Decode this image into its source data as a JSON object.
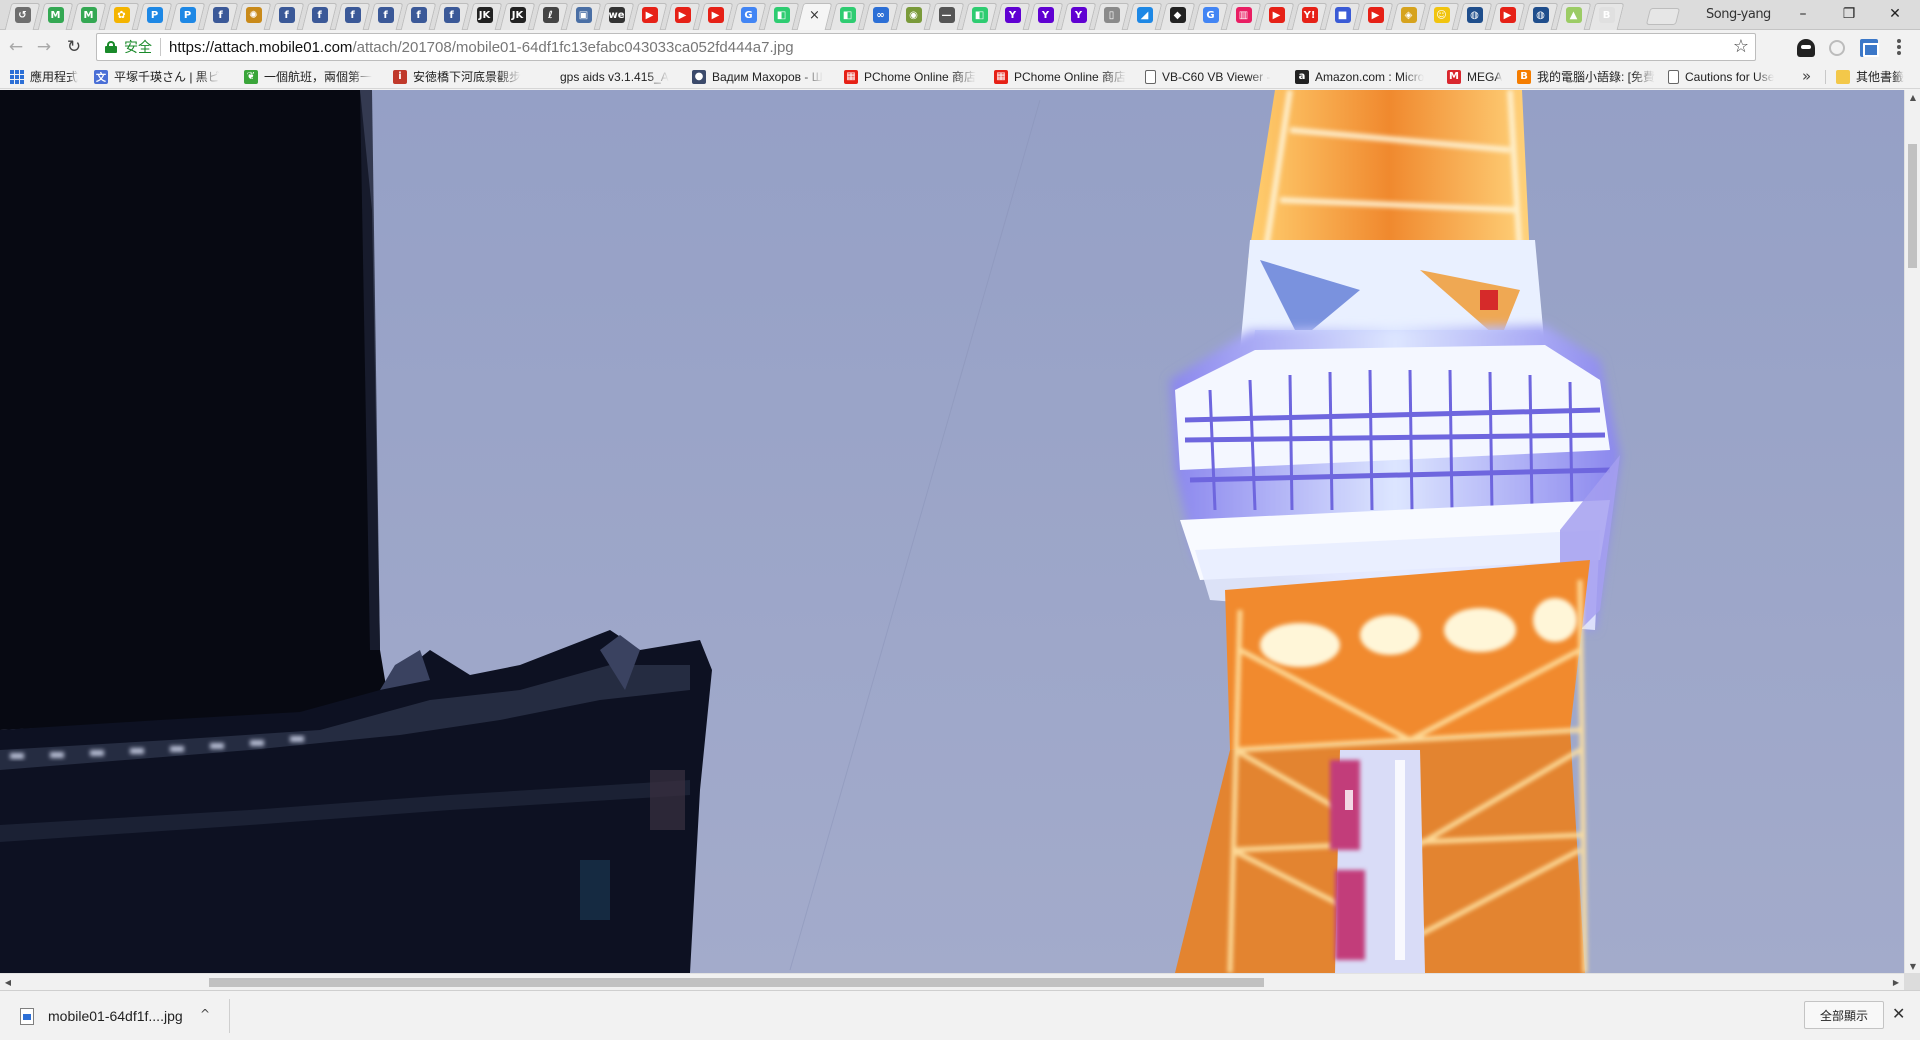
{
  "browser": {
    "profile_name": "Song-yang",
    "window_controls": {
      "minimize": "–",
      "restore": "❐",
      "close": "✕"
    },
    "active_tab_close": "×"
  },
  "tabs": [
    {
      "icon": "history-icon",
      "glyph": "↺",
      "color": "#6e6e6e"
    },
    {
      "icon": "google-maps-icon",
      "glyph": "M",
      "color": "#34a853"
    },
    {
      "icon": "google-maps-icon",
      "glyph": "M",
      "color": "#34a853"
    },
    {
      "icon": "google-photos-icon",
      "glyph": "✿",
      "color": "#f4b400"
    },
    {
      "icon": "pixnet-icon",
      "glyph": "P",
      "color": "#1e88e5"
    },
    {
      "icon": "pixnet-icon",
      "glyph": "P",
      "color": "#1e88e5"
    },
    {
      "icon": "facebook-icon",
      "glyph": "f",
      "color": "#3b5998"
    },
    {
      "icon": "wheel-icon",
      "glyph": "✺",
      "color": "#c98a1a"
    },
    {
      "icon": "facebook-icon",
      "glyph": "f",
      "color": "#3b5998"
    },
    {
      "icon": "facebook-icon",
      "glyph": "f",
      "color": "#3b5998"
    },
    {
      "icon": "facebook-icon",
      "glyph": "f",
      "color": "#3b5998"
    },
    {
      "icon": "facebook-icon",
      "glyph": "f",
      "color": "#3b5998"
    },
    {
      "icon": "facebook-icon",
      "glyph": "f",
      "color": "#3b5998"
    },
    {
      "icon": "facebook-icon",
      "glyph": "f",
      "color": "#3b5998"
    },
    {
      "icon": "jk-icon",
      "glyph": "JK",
      "color": "#222222"
    },
    {
      "icon": "jk-icon",
      "glyph": "JK",
      "color": "#222222"
    },
    {
      "icon": "feather-icon",
      "glyph": "ℓ",
      "color": "#444444"
    },
    {
      "icon": "map-pin-icon",
      "glyph": "▣",
      "color": "#4a6fa5"
    },
    {
      "icon": "wechat-icon",
      "glyph": "we",
      "color": "#333333"
    },
    {
      "icon": "youtube-icon",
      "glyph": "▶",
      "color": "#e62117"
    },
    {
      "icon": "youtube-icon",
      "glyph": "▶",
      "color": "#e62117"
    },
    {
      "icon": "youtube-icon",
      "glyph": "▶",
      "color": "#e62117"
    },
    {
      "icon": "google-icon",
      "glyph": "G",
      "color": "#4285f4"
    },
    {
      "icon": "green-app-icon",
      "glyph": "◧",
      "color": "#2ecc71"
    },
    {
      "icon": "close-tab-icon",
      "glyph": "×",
      "color": "#333333",
      "active": true
    },
    {
      "icon": "green-app-icon",
      "glyph": "◧",
      "color": "#2ecc71"
    },
    {
      "icon": "link-icon",
      "glyph": "∞",
      "color": "#2c6fd6"
    },
    {
      "icon": "android-icon",
      "glyph": "◉",
      "color": "#7a9a3a"
    },
    {
      "icon": "dash-icon",
      "glyph": "—",
      "color": "#555555"
    },
    {
      "icon": "green-app-icon",
      "glyph": "◧",
      "color": "#2ecc71"
    },
    {
      "icon": "yahoo-icon",
      "glyph": "Y",
      "color": "#6001d2"
    },
    {
      "icon": "yahoo-icon",
      "glyph": "Y",
      "color": "#6001d2"
    },
    {
      "icon": "yahoo-icon",
      "glyph": "Y",
      "color": "#6001d2"
    },
    {
      "icon": "document-icon",
      "glyph": "▯",
      "color": "#8a8a8a"
    },
    {
      "icon": "chart-icon",
      "glyph": "◢",
      "color": "#1e88e5"
    },
    {
      "icon": "drop-icon",
      "glyph": "◆",
      "color": "#222222"
    },
    {
      "icon": "google-icon",
      "glyph": "G",
      "color": "#4285f4"
    },
    {
      "icon": "pink-app-icon",
      "glyph": "▥",
      "color": "#e91e63"
    },
    {
      "icon": "youtube-icon",
      "glyph": "▶",
      "color": "#e62117"
    },
    {
      "icon": "yahoo-tw-icon",
      "glyph": "Y!",
      "color": "#e62117"
    },
    {
      "icon": "chat-icon",
      "glyph": "■",
      "color": "#3a5bd6"
    },
    {
      "icon": "youtube-icon",
      "glyph": "▶",
      "color": "#e62117"
    },
    {
      "icon": "shield-icon",
      "glyph": "◈",
      "color": "#d6a31e"
    },
    {
      "icon": "smile-icon",
      "glyph": "☺",
      "color": "#f1c40f"
    },
    {
      "icon": "globe-icon",
      "glyph": "◍",
      "color": "#1f4e8c"
    },
    {
      "icon": "youtube-icon",
      "glyph": "▶",
      "color": "#e62117"
    },
    {
      "icon": "globe-icon",
      "glyph": "◍",
      "color": "#1f4e8c"
    },
    {
      "icon": "android-icon",
      "glyph": "▲",
      "color": "#9ccc65"
    },
    {
      "icon": "blank-b-icon",
      "glyph": "B",
      "color": "#e0e0e0"
    }
  ],
  "toolbar": {
    "back": "←",
    "forward": "→",
    "reload": "↻",
    "secure_label": "安全",
    "url_host": "https://attach.mobile01.com",
    "url_path": "/attach/201708/mobile01-64df1fc13efabc043033ca052fd444a7.jpg",
    "star": "☆"
  },
  "bookmarks": [
    {
      "label": "應用程式",
      "icon": "apps-grid-icon",
      "color": "#2c6fd6",
      "glyph": ""
    },
    {
      "label": "平塚千瑛さん | 黒ビ",
      "icon": "translate-icon",
      "color": "#4a6fd6",
      "glyph": "文"
    },
    {
      "label": "一個航班，兩個第一",
      "icon": "bird-icon",
      "color": "#3aa53a",
      "glyph": "❦"
    },
    {
      "label": "安徳橋下河底景觀步",
      "icon": "iyf-icon",
      "color": "#c0392b",
      "glyph": "i"
    },
    {
      "label": "gps aids v3.1.415_A",
      "icon": "blank-icon",
      "color": "#f2f2f2",
      "glyph": ""
    },
    {
      "label": "Вадим Махоров - Ш",
      "icon": "person-icon",
      "color": "#3b4a6b",
      "glyph": "●"
    },
    {
      "label": "PChome Online 商店",
      "icon": "pchome-icon",
      "color": "#e62117",
      "glyph": "▦"
    },
    {
      "label": "PChome Online 商店",
      "icon": "pchome-icon",
      "color": "#e62117",
      "glyph": "▦"
    },
    {
      "label": "VB-C60 VB Viewer -",
      "icon": "page-icon",
      "color": "#ffffff",
      "glyph": ""
    },
    {
      "label": "Amazon.com : Micro",
      "icon": "amazon-icon",
      "color": "#222222",
      "glyph": "a"
    },
    {
      "label": "MEGA",
      "icon": "mega-icon",
      "color": "#d9272e",
      "glyph": "M"
    },
    {
      "label": "我的電腦小語錄: [免費",
      "icon": "blogger-icon",
      "color": "#f57d00",
      "glyph": "B"
    },
    {
      "label": "Cautions for Use",
      "icon": "page-icon",
      "color": "#ffffff",
      "glyph": ""
    }
  ],
  "bookmarks_overflow": "»",
  "other_bookmarks": "其他書籤",
  "download": {
    "filename": "mobile01-64df1f....jpg",
    "caret": "^",
    "show_all": "全部顯示",
    "close": "✕"
  },
  "scrollbar": {
    "up": "▲",
    "down": "▼",
    "left": "◀",
    "right": "▶"
  },
  "colors": {
    "sky": "#98a2c6",
    "tower_orange": "#e8802a",
    "tower_white": "#eef3ff",
    "tower_blue": "#7a72e0",
    "pagoda": "#0c0e1c"
  }
}
